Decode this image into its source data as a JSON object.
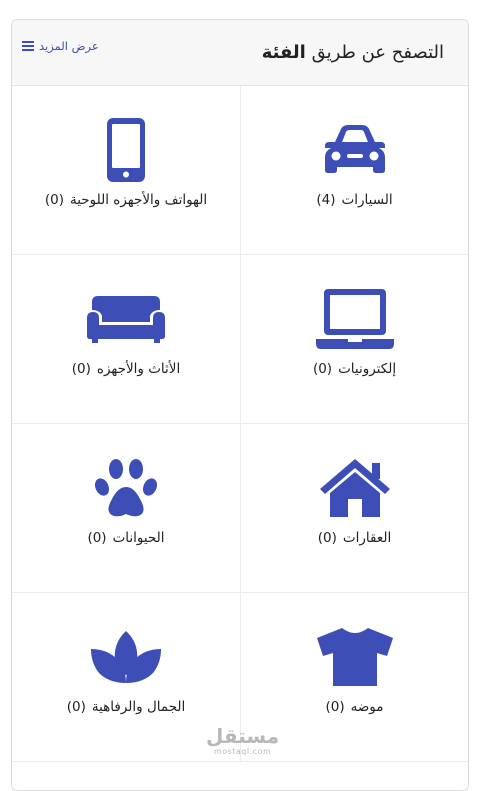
{
  "header": {
    "title_prefix": "التصفح عن طريق",
    "title_emphasis": "الفئة",
    "see_more_label": "عرض المزيد"
  },
  "categories": [
    {
      "label": "السيارات",
      "count": "(4)",
      "icon": "car-icon"
    },
    {
      "label": "الهواتف والأجهزه اللوحية",
      "count": "(0)",
      "icon": "mobile-phone-icon"
    },
    {
      "label": "إلكترونيات",
      "count": "(0)",
      "icon": "laptop-icon"
    },
    {
      "label": "الأثاث والأجهزه",
      "count": "(0)",
      "icon": "sofa-icon"
    },
    {
      "label": "العقارات",
      "count": "(0)",
      "icon": "house-icon"
    },
    {
      "label": "الحيوانات",
      "count": "(0)",
      "icon": "paw-icon"
    },
    {
      "label": "موضه",
      "count": "(0)",
      "icon": "tshirt-icon"
    },
    {
      "label": "الجمال والرفاهية",
      "count": "(0)",
      "icon": "lotus-icon"
    }
  ],
  "watermark": {
    "main": "مستقل",
    "sub": "mostaql.com"
  },
  "colors": {
    "accent": "#3d4fb6",
    "header_bg": "#f7f7f7"
  }
}
